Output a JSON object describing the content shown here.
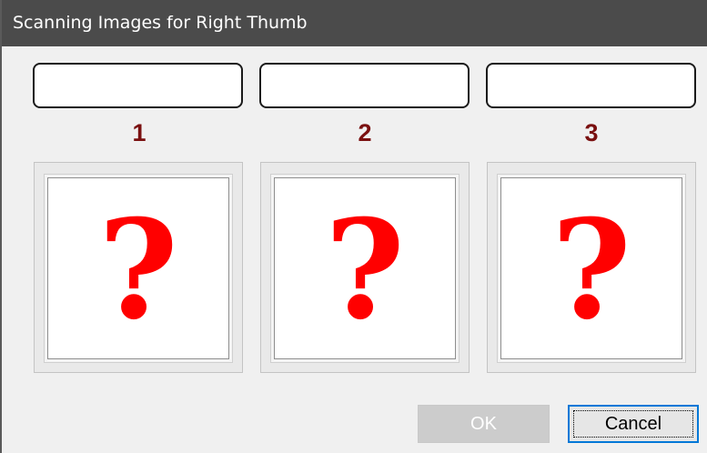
{
  "window": {
    "title": "Scanning Images for Right Thumb"
  },
  "slots": [
    {
      "number": "1",
      "status": "",
      "image_icon": "question-mark-icon",
      "image_glyph": "?"
    },
    {
      "number": "2",
      "status": "",
      "image_icon": "question-mark-icon",
      "image_glyph": "?"
    },
    {
      "number": "3",
      "status": "",
      "image_icon": "question-mark-icon",
      "image_glyph": "?"
    }
  ],
  "buttons": {
    "ok_label": "OK",
    "ok_enabled": false,
    "cancel_label": "Cancel"
  },
  "colors": {
    "title_bar": "#4b4b4b",
    "number_label": "#7a1010",
    "placeholder_icon": "#ff0000",
    "focus_accent": "#0078d7"
  }
}
